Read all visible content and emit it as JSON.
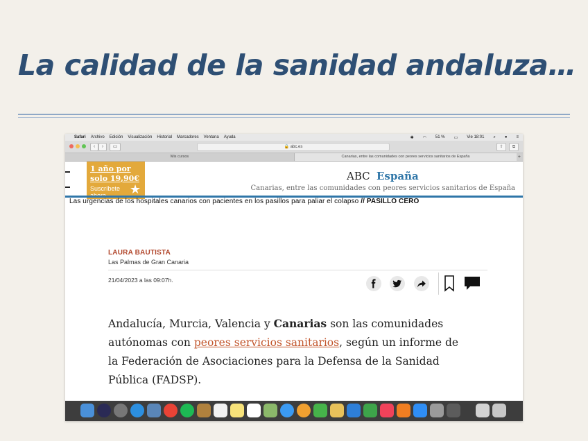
{
  "slide": {
    "title": "La calidad de la sanidad andaluza…"
  },
  "mac_menubar": {
    "items": [
      "Safari",
      "Archivo",
      "Edición",
      "Visualización",
      "Historial",
      "Marcadores",
      "Ventana",
      "Ayuda"
    ],
    "battery": "51 %",
    "clock": "Vie 18:01"
  },
  "browser": {
    "url": "abc.es",
    "tabs": [
      {
        "label": "Mis cursos"
      },
      {
        "label": "Canarias, entre las comunidades con peores servicios sanitarios de España"
      }
    ]
  },
  "promo": {
    "line1": "1 año por",
    "line2": "solo 19,90€",
    "cta_line1": "Suscríbete",
    "cta_line2": "ahora"
  },
  "header": {
    "brand": "ABC",
    "section": "España",
    "subtitle": "Canarias, entre las comunidades con peores servicios sanitarios de España"
  },
  "ticker": {
    "text": "Las urgencias de los hospitales canarios con pacientes en los pasillos para paliar el colapso",
    "tag": "// PASILLO CERO"
  },
  "article": {
    "author": "LAURA BAUTISTA",
    "location": "Las Palmas de Gran Canaria",
    "date": "21/04/2023 a las 09:07h.",
    "body": {
      "l1_a": "Andalucía, Murcia, Valencia y ",
      "l1_b": "Canarias",
      "l1_c": " son las comunidades",
      "l2_a": "autónomas con ",
      "l2_link": "peores servicios sanitarios",
      "l2_c": ", según un informe de",
      "l3": "la Federación de Asociaciones para la Defensa de la Sanidad",
      "l4": "Pública (FADSP)."
    }
  },
  "colors": {
    "title": "#2e4f74",
    "accent_blue": "#2f76a8",
    "promo": "#e3a93b",
    "author": "#b1462b",
    "link": "#c2552b"
  }
}
